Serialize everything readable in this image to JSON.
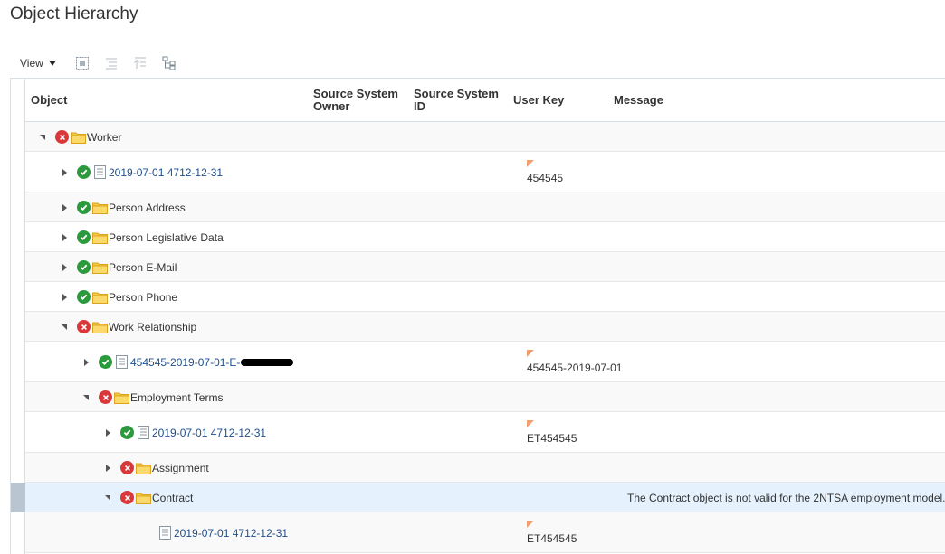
{
  "page": {
    "title": "Object Hierarchy"
  },
  "toolbar": {
    "view_label": "View",
    "icons": [
      "expand-all-icon",
      "collapse-icon",
      "collapse-all-icon",
      "hierarchy-icon"
    ]
  },
  "table": {
    "columns": {
      "object": "Object",
      "source_system_owner": "Source System Owner",
      "source_system_id": "Source System ID",
      "user_key": "User Key",
      "message": "Message"
    },
    "rows": [
      {
        "label": "Worker",
        "status": "error",
        "type": "folder",
        "expand": "expanded",
        "level": 0,
        "user_key": "",
        "message": "",
        "link": false
      },
      {
        "label": "2019-07-01 4712-12-31",
        "status": "ok",
        "type": "document",
        "expand": "collapsed",
        "level": 1,
        "user_key": "454545",
        "message": "",
        "link": true
      },
      {
        "label": "Person Address",
        "status": "ok",
        "type": "folder",
        "expand": "collapsed",
        "level": 1,
        "user_key": "",
        "message": "",
        "link": false
      },
      {
        "label": "Person Legislative Data",
        "status": "ok",
        "type": "folder",
        "expand": "collapsed",
        "level": 1,
        "user_key": "",
        "message": "",
        "link": false
      },
      {
        "label": "Person E-Mail",
        "status": "ok",
        "type": "folder",
        "expand": "collapsed",
        "level": 1,
        "user_key": "",
        "message": "",
        "link": false
      },
      {
        "label": "Person Phone",
        "status": "ok",
        "type": "folder",
        "expand": "collapsed",
        "level": 1,
        "user_key": "",
        "message": "",
        "link": false
      },
      {
        "label": "Work Relationship",
        "status": "error",
        "type": "folder",
        "expand": "expanded",
        "level": 1,
        "user_key": "",
        "message": "",
        "link": false
      },
      {
        "label": "454545-2019-07-01-E-",
        "status": "ok",
        "type": "document",
        "expand": "collapsed",
        "level": 2,
        "user_key": "454545-2019-07-01",
        "message": "",
        "link": true,
        "redacted": true
      },
      {
        "label": "Employment Terms",
        "status": "error",
        "type": "folder",
        "expand": "expanded",
        "level": 2,
        "user_key": "",
        "message": "",
        "link": false
      },
      {
        "label": "2019-07-01 4712-12-31",
        "status": "ok",
        "type": "document",
        "expand": "collapsed",
        "level": 3,
        "user_key": "ET454545",
        "message": "",
        "link": true
      },
      {
        "label": "Assignment",
        "status": "error",
        "type": "folder",
        "expand": "collapsed",
        "level": 3,
        "user_key": "",
        "message": "",
        "link": false
      },
      {
        "label": "Contract",
        "status": "error",
        "type": "folder",
        "expand": "expanded",
        "level": 3,
        "user_key": "",
        "message": "The Contract object is not valid for the 2NTSA employment model.",
        "link": false,
        "selected": true
      },
      {
        "label": "2019-07-01 4712-12-31",
        "status": "none",
        "type": "document",
        "expand": "none",
        "level": 4,
        "user_key": "ET454545",
        "message": "",
        "link": true
      }
    ]
  },
  "colors": {
    "ok": "#2a9a3d",
    "error": "#d9383a",
    "link": "#1e4f8c",
    "folder": "#f5c842",
    "selected_row": "#e5f1fc",
    "flag": "#f0a070"
  }
}
